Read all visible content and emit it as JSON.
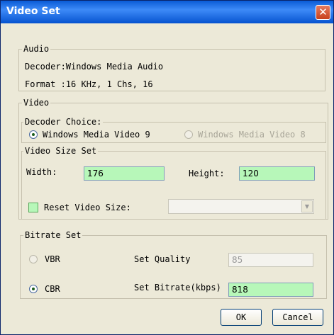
{
  "window": {
    "title": "Video Set",
    "close_glyph": "✕"
  },
  "audio": {
    "legend": "Audio",
    "decoder_line": "Decoder:Windows Media Audio",
    "format_line": "Format :16 KHz, 1 Chs, 16"
  },
  "video": {
    "legend": "Video",
    "decoder_choice": {
      "legend": "Decoder Choice:",
      "options": [
        {
          "label": "Windows Media Video 9",
          "selected": true,
          "enabled": true
        },
        {
          "label": "Windows Media Video 8",
          "selected": false,
          "enabled": false
        }
      ]
    },
    "size": {
      "legend": "Video Size Set",
      "width_label": "Width:",
      "width_value": "176",
      "height_label": "Height:",
      "height_value": "120",
      "reset_label": "Reset Video Size:",
      "reset_checked": false,
      "size_select_value": ""
    }
  },
  "bitrate": {
    "legend": "Bitrate Set",
    "vbr_label": "VBR",
    "cbr_label": "CBR",
    "mode": "CBR",
    "quality_label": "Set Quality",
    "quality_value": "85",
    "bitrate_label": "Set Bitrate(kbps)",
    "bitrate_value": "818"
  },
  "buttons": {
    "ok": "OK",
    "cancel": "Cancel"
  },
  "colors": {
    "titlebar": "#0a5bd6",
    "field_bg": "#b7f7b9",
    "dialog_bg": "#ece9d8"
  }
}
